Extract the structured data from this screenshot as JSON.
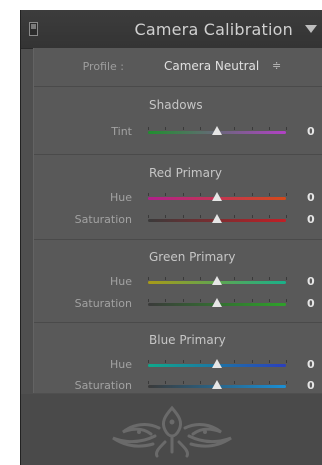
{
  "panel": {
    "title": "Camera Calibration",
    "toggle_icon": "panel-toggle-switch",
    "collapse_icon": "triangle-down-icon"
  },
  "profile": {
    "label": "Profile :",
    "value": "Camera Neutral",
    "arrows": "≑"
  },
  "sections": [
    {
      "title": "Shadows",
      "rows": [
        {
          "label": "Tint",
          "value": "0",
          "level": 0.5,
          "colors": [
            "#1f8f2e",
            "#b241c6"
          ]
        }
      ]
    },
    {
      "title": "Red Primary",
      "rows": [
        {
          "label": "Hue",
          "value": "0",
          "level": 0.5,
          "colors": [
            "#b0208c",
            "#d44a1a"
          ]
        },
        {
          "label": "Saturation",
          "value": "0",
          "level": 0.5,
          "colors": [
            "#3a3a3a",
            "#c21f26"
          ]
        }
      ]
    },
    {
      "title": "Green Primary",
      "rows": [
        {
          "label": "Hue",
          "value": "0",
          "level": 0.5,
          "colors": [
            "#a89a18",
            "#19b08a"
          ]
        },
        {
          "label": "Saturation",
          "value": "0",
          "level": 0.5,
          "colors": [
            "#3a3a3a",
            "#2ea22a"
          ]
        }
      ]
    },
    {
      "title": "Blue Primary",
      "rows": [
        {
          "label": "Hue",
          "value": "0",
          "level": 0.5,
          "colors": [
            "#0fa98b",
            "#2b3fbe"
          ]
        },
        {
          "label": "Saturation",
          "value": "0",
          "level": 0.5,
          "colors": [
            "#3a3a3a",
            "#1a8fd6"
          ]
        }
      ]
    }
  ],
  "footer": {
    "ornament_icon": "tribal-ornament-icon"
  }
}
